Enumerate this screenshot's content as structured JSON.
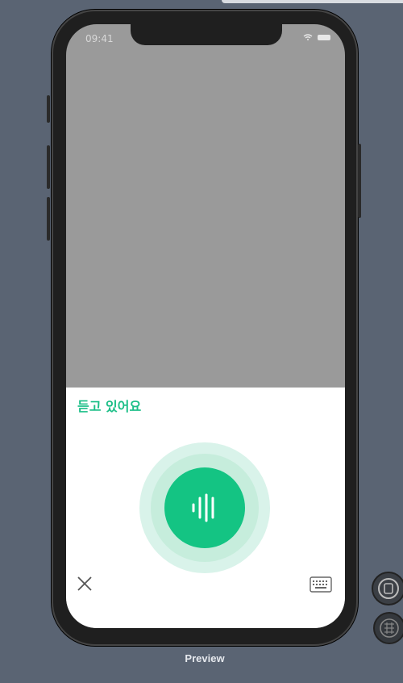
{
  "status_bar": {
    "time": "09:41"
  },
  "voice_sheet": {
    "title": "듣고 있어요",
    "accent_color": "#14c483",
    "close_icon": "close-icon",
    "keyboard_icon": "keyboard-icon",
    "mic_icon": "waveform-icon"
  },
  "preview": {
    "label": "Preview"
  }
}
